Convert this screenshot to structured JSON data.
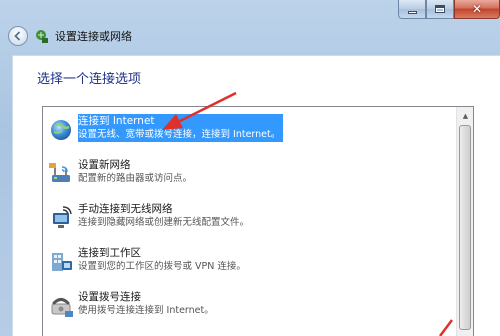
{
  "window": {
    "title": "设置连接或网络",
    "controls": {
      "minimize": "",
      "maximize": "",
      "close": "✕"
    }
  },
  "prompt": "选择一个连接选项",
  "options": [
    {
      "icon": "globe-icon",
      "title": "连接到 Internet",
      "description": "设置无线、宽带或拨号连接，连接到 Internet。",
      "selected": true
    },
    {
      "icon": "router-icon",
      "title": "设置新网络",
      "description": "配置新的路由器或访问点。",
      "selected": false
    },
    {
      "icon": "wireless-network-icon",
      "title": "手动连接到无线网络",
      "description": "连接到隐藏网络或创建新无线配置文件。",
      "selected": false
    },
    {
      "icon": "workplace-icon",
      "title": "连接到工作区",
      "description": "设置到您的工作区的拨号或 VPN 连接。",
      "selected": false
    },
    {
      "icon": "dialup-phone-icon",
      "title": "设置拨号连接",
      "description": "使用拨号连接连接到 Internet。",
      "selected": false
    }
  ],
  "colors": {
    "selection": "#3399ff",
    "prompt_text": "#1e3287",
    "annotation_arrow": "#e0302a"
  }
}
